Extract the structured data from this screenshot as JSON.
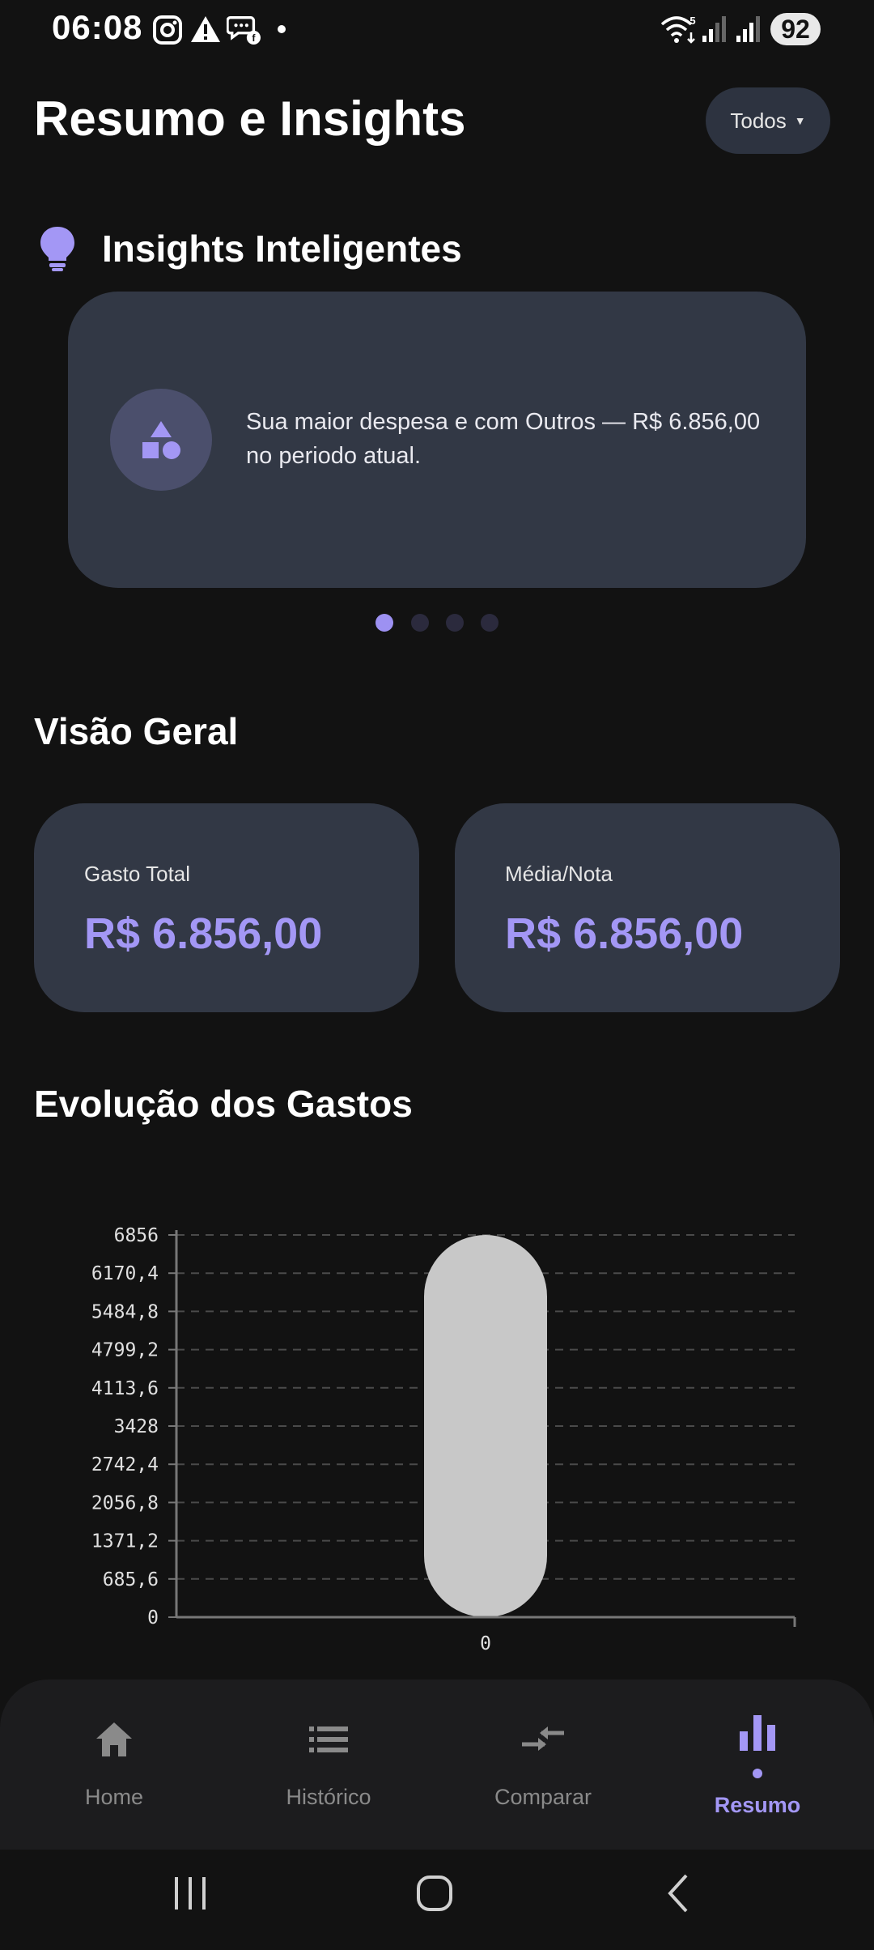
{
  "status_bar": {
    "time": "06:08",
    "battery": "92",
    "wifi_label": "5"
  },
  "header": {
    "title": "Resumo e Insights",
    "filter_label": "Todos"
  },
  "insights": {
    "section_title": "Insights Inteligentes",
    "card_text": "Sua maior despesa e com Outros — R$ 6.856,00 no periodo atual.",
    "page_count": 4,
    "active_page": 0
  },
  "overview": {
    "section_title": "Visão Geral",
    "total_label": "Gasto Total",
    "total_value": "R$ 6.856,00",
    "avg_label": "Média/Nota",
    "avg_value": "R$ 6.856,00"
  },
  "chart_section": {
    "title": "Evolução dos Gastos"
  },
  "chart_data": {
    "type": "bar",
    "categories": [
      "0"
    ],
    "values": [
      6856
    ],
    "ylim": [
      0,
      6856
    ],
    "yticks": [
      "0",
      "685,6",
      "1371,2",
      "2056,8",
      "2742,4",
      "3428",
      "4113,6",
      "4799,2",
      "5484,8",
      "6170,4",
      "6856"
    ],
    "grid": true,
    "bar_color": "#c8c8c8"
  },
  "bottom_nav": {
    "items": [
      {
        "label": "Home",
        "icon": "home-icon"
      },
      {
        "label": "Histórico",
        "icon": "list-icon"
      },
      {
        "label": "Comparar",
        "icon": "compare-arrows-icon"
      },
      {
        "label": "Resumo",
        "icon": "bar-chart-icon"
      }
    ],
    "active_index": 3
  },
  "colors": {
    "background": "#121212",
    "card": "#323845",
    "accent": "#a397f5",
    "inactive": "#8a8a8a"
  }
}
